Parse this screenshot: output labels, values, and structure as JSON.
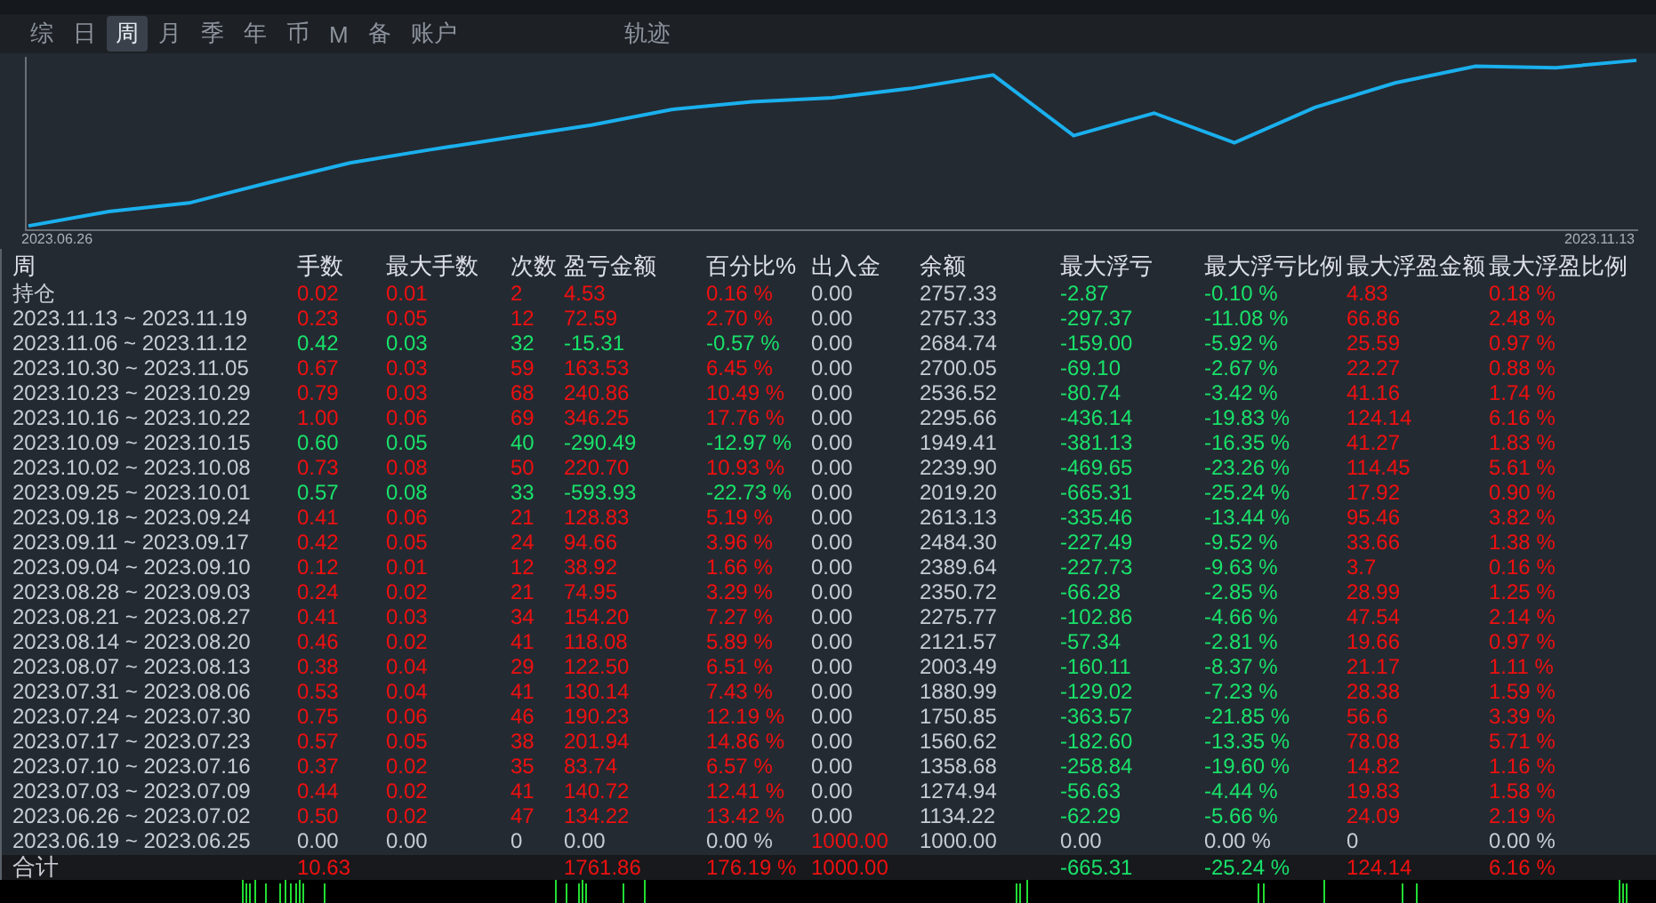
{
  "tabs": [
    {
      "label": "综",
      "selected": false
    },
    {
      "label": "日",
      "selected": false
    },
    {
      "label": "周",
      "selected": true
    },
    {
      "label": "月",
      "selected": false
    },
    {
      "label": "季",
      "selected": false
    },
    {
      "label": "年",
      "selected": false
    },
    {
      "label": "币",
      "selected": false
    },
    {
      "label": "M",
      "selected": false
    },
    {
      "label": "备",
      "selected": false
    },
    {
      "label": "账户",
      "selected": false
    }
  ],
  "chart_label": "轨迹",
  "equity_chart": {
    "start_label": "2023.06.26",
    "end_label": "2023.11.13"
  },
  "table": {
    "columns": [
      "周",
      "手数",
      "最大手数",
      "次数",
      "盈亏金额",
      "百分比%",
      "出入金",
      "余额",
      "最大浮亏",
      "最大浮亏比例",
      "最大浮盈金额",
      "最大浮盈比例"
    ],
    "rows": [
      {
        "kind": "profit",
        "deposit": false,
        "cells": [
          "持仓",
          "0.02",
          "0.01",
          "2",
          "4.53",
          "0.16 %",
          "0.00",
          "2757.33",
          "-2.87",
          "-0.10 %",
          "4.83",
          "0.18 %"
        ]
      },
      {
        "kind": "profit",
        "deposit": false,
        "cells": [
          "2023.11.13 ~ 2023.11.19",
          "0.23",
          "0.05",
          "12",
          "72.59",
          "2.70 %",
          "0.00",
          "2757.33",
          "-297.37",
          "-11.08 %",
          "66.86",
          "2.48 %"
        ]
      },
      {
        "kind": "loss",
        "deposit": false,
        "cells": [
          "2023.11.06 ~ 2023.11.12",
          "0.42",
          "0.03",
          "32",
          "-15.31",
          "-0.57 %",
          "0.00",
          "2684.74",
          "-159.00",
          "-5.92 %",
          "25.59",
          "0.97 %"
        ]
      },
      {
        "kind": "profit",
        "deposit": false,
        "cells": [
          "2023.10.30 ~ 2023.11.05",
          "0.67",
          "0.03",
          "59",
          "163.53",
          "6.45 %",
          "0.00",
          "2700.05",
          "-69.10",
          "-2.67 %",
          "22.27",
          "0.88 %"
        ]
      },
      {
        "kind": "profit",
        "deposit": false,
        "cells": [
          "2023.10.23 ~ 2023.10.29",
          "0.79",
          "0.03",
          "68",
          "240.86",
          "10.49 %",
          "0.00",
          "2536.52",
          "-80.74",
          "-3.42 %",
          "41.16",
          "1.74 %"
        ]
      },
      {
        "kind": "profit",
        "deposit": false,
        "cells": [
          "2023.10.16 ~ 2023.10.22",
          "1.00",
          "0.06",
          "69",
          "346.25",
          "17.76 %",
          "0.00",
          "2295.66",
          "-436.14",
          "-19.83 %",
          "124.14",
          "6.16 %"
        ]
      },
      {
        "kind": "loss",
        "deposit": false,
        "cells": [
          "2023.10.09 ~ 2023.10.15",
          "0.60",
          "0.05",
          "40",
          "-290.49",
          "-12.97 %",
          "0.00",
          "1949.41",
          "-381.13",
          "-16.35 %",
          "41.27",
          "1.83 %"
        ]
      },
      {
        "kind": "profit",
        "deposit": false,
        "cells": [
          "2023.10.02 ~ 2023.10.08",
          "0.73",
          "0.08",
          "50",
          "220.70",
          "10.93 %",
          "0.00",
          "2239.90",
          "-469.65",
          "-23.26 %",
          "114.45",
          "5.61 %"
        ]
      },
      {
        "kind": "loss",
        "deposit": false,
        "cells": [
          "2023.09.25 ~ 2023.10.01",
          "0.57",
          "0.08",
          "33",
          "-593.93",
          "-22.73 %",
          "0.00",
          "2019.20",
          "-665.31",
          "-25.24 %",
          "17.92",
          "0.90 %"
        ]
      },
      {
        "kind": "profit",
        "deposit": false,
        "cells": [
          "2023.09.18 ~ 2023.09.24",
          "0.41",
          "0.06",
          "21",
          "128.83",
          "5.19 %",
          "0.00",
          "2613.13",
          "-335.46",
          "-13.44 %",
          "95.46",
          "3.82 %"
        ]
      },
      {
        "kind": "profit",
        "deposit": false,
        "cells": [
          "2023.09.11 ~ 2023.09.17",
          "0.42",
          "0.05",
          "24",
          "94.66",
          "3.96 %",
          "0.00",
          "2484.30",
          "-227.49",
          "-9.52 %",
          "33.66",
          "1.38 %"
        ]
      },
      {
        "kind": "profit",
        "deposit": false,
        "cells": [
          "2023.09.04 ~ 2023.09.10",
          "0.12",
          "0.01",
          "12",
          "38.92",
          "1.66 %",
          "0.00",
          "2389.64",
          "-227.73",
          "-9.63 %",
          "3.7",
          "0.16 %"
        ]
      },
      {
        "kind": "profit",
        "deposit": false,
        "cells": [
          "2023.08.28 ~ 2023.09.03",
          "0.24",
          "0.02",
          "21",
          "74.95",
          "3.29 %",
          "0.00",
          "2350.72",
          "-66.28",
          "-2.85 %",
          "28.99",
          "1.25 %"
        ]
      },
      {
        "kind": "profit",
        "deposit": false,
        "cells": [
          "2023.08.21 ~ 2023.08.27",
          "0.41",
          "0.03",
          "34",
          "154.20",
          "7.27 %",
          "0.00",
          "2275.77",
          "-102.86",
          "-4.66 %",
          "47.54",
          "2.14 %"
        ]
      },
      {
        "kind": "profit",
        "deposit": false,
        "cells": [
          "2023.08.14 ~ 2023.08.20",
          "0.46",
          "0.02",
          "41",
          "118.08",
          "5.89 %",
          "0.00",
          "2121.57",
          "-57.34",
          "-2.81 %",
          "19.66",
          "0.97 %"
        ]
      },
      {
        "kind": "profit",
        "deposit": false,
        "cells": [
          "2023.08.07 ~ 2023.08.13",
          "0.38",
          "0.04",
          "29",
          "122.50",
          "6.51 %",
          "0.00",
          "2003.49",
          "-160.11",
          "-8.37 %",
          "21.17",
          "1.11 %"
        ]
      },
      {
        "kind": "profit",
        "deposit": false,
        "cells": [
          "2023.07.31 ~ 2023.08.06",
          "0.53",
          "0.04",
          "41",
          "130.14",
          "7.43 %",
          "0.00",
          "1880.99",
          "-129.02",
          "-7.23 %",
          "28.38",
          "1.59 %"
        ]
      },
      {
        "kind": "profit",
        "deposit": false,
        "cells": [
          "2023.07.24 ~ 2023.07.30",
          "0.75",
          "0.06",
          "46",
          "190.23",
          "12.19 %",
          "0.00",
          "1750.85",
          "-363.57",
          "-21.85 %",
          "56.6",
          "3.39 %"
        ]
      },
      {
        "kind": "profit",
        "deposit": false,
        "cells": [
          "2023.07.17 ~ 2023.07.23",
          "0.57",
          "0.05",
          "38",
          "201.94",
          "14.86 %",
          "0.00",
          "1560.62",
          "-182.60",
          "-13.35 %",
          "78.08",
          "5.71 %"
        ]
      },
      {
        "kind": "profit",
        "deposit": false,
        "cells": [
          "2023.07.10 ~ 2023.07.16",
          "0.37",
          "0.02",
          "35",
          "83.74",
          "6.57 %",
          "0.00",
          "1358.68",
          "-258.84",
          "-19.60 %",
          "14.82",
          "1.16 %"
        ]
      },
      {
        "kind": "profit",
        "deposit": false,
        "cells": [
          "2023.07.03 ~ 2023.07.09",
          "0.44",
          "0.02",
          "41",
          "140.72",
          "12.41 %",
          "0.00",
          "1274.94",
          "-56.63",
          "-4.44 %",
          "19.83",
          "1.58 %"
        ]
      },
      {
        "kind": "profit",
        "deposit": false,
        "cells": [
          "2023.06.26 ~ 2023.07.02",
          "0.50",
          "0.02",
          "47",
          "134.22",
          "13.42 %",
          "0.00",
          "1134.22",
          "-62.29",
          "-5.66 %",
          "24.09",
          "2.19 %"
        ]
      },
      {
        "kind": "flat",
        "deposit": true,
        "cells": [
          "2023.06.19 ~ 2023.06.25",
          "0.00",
          "0.00",
          "0",
          "0.00",
          "0.00 %",
          "1000.00",
          "1000.00",
          "0.00",
          "0.00 %",
          "0",
          "0.00 %"
        ]
      }
    ],
    "total": {
      "kind": "profit",
      "deposit": true,
      "cells": [
        "合计",
        "10.63",
        "",
        "",
        "1761.86",
        "176.19 %",
        "1000.00",
        "",
        "-665.31",
        "-25.24 %",
        "124.14",
        "6.16 %"
      ]
    }
  }
}
